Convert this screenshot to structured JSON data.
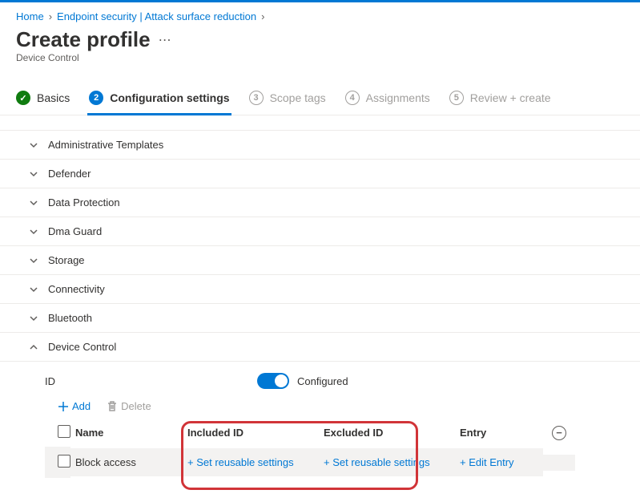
{
  "breadcrumb": {
    "home": "Home",
    "parent": "Endpoint security | Attack surface reduction"
  },
  "page": {
    "title": "Create profile",
    "subtitle": "Device Control"
  },
  "tabs": {
    "basics": "Basics",
    "config": "Configuration settings",
    "scope": "Scope tags",
    "assign": "Assignments",
    "review": "Review + create",
    "n2": "2",
    "n3": "3",
    "n4": "4",
    "n5": "5"
  },
  "sections": {
    "admin": "Administrative Templates",
    "defender": "Defender",
    "dataprot": "Data Protection",
    "dma": "Dma Guard",
    "storage": "Storage",
    "conn": "Connectivity",
    "bt": "Bluetooth",
    "dc": "Device Control"
  },
  "dc": {
    "id_label": "ID",
    "configured": "Configured",
    "add": "Add",
    "delete": "Delete",
    "col_name": "Name",
    "col_included": "Included ID",
    "col_excluded": "Excluded ID",
    "col_entry": "Entry",
    "row_name": "Block access",
    "set_reusable": "+ Set reusable settings",
    "edit_entry": "+ Edit Entry"
  }
}
